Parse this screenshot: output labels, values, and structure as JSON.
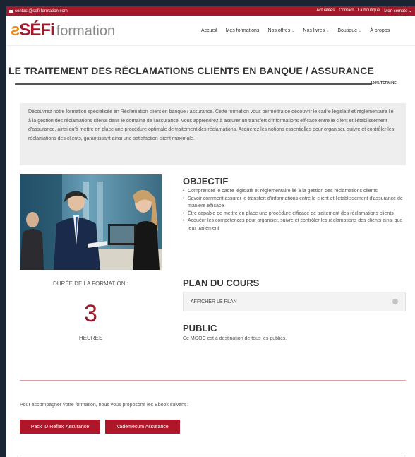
{
  "topbar": {
    "email": "contact@sefi-formation.com",
    "links": [
      "Actualités",
      "Contact",
      "La boutique",
      "Mon compte ⌄"
    ]
  },
  "logo": {
    "brand_z": "ƨ",
    "brand_rest": "SÉFi",
    "word": "formation"
  },
  "nav": [
    {
      "label": "Accueil",
      "has_caret": false
    },
    {
      "label": "Mes formations",
      "has_caret": false
    },
    {
      "label": "Nos offres",
      "has_caret": true
    },
    {
      "label": "Nos livres",
      "has_caret": true
    },
    {
      "label": "Boutique",
      "has_caret": true
    },
    {
      "label": "À propos",
      "has_caret": false
    }
  ],
  "page_title": "LE TRAITEMENT DES RÉCLAMATIONS CLIENTS EN BANQUE / ASSURANCE",
  "progress": {
    "percent": 100,
    "label": "100% TERMINÉ"
  },
  "intro": "Découvrez notre formation spécialisée en Réclamation client en banque / assurance. Cette formation vous permettra de découvrir le cadre législatif et réglementaire lié à la gestion des réclamations clients dans le domaine de l'assurance. Vous apprendrez à assurer un transfert d'informations efficace entre le client et l'établissement d'assurance, ainsi qu'à mettre en place une procédure optimale de traitement des réclamations. Acquérez les notions essentielles pour organiser, suivre et contrôler les réclamations des clients, garantissant ainsi une satisfaction client maximale.",
  "duration": {
    "label": "DURÉE DE LA FORMATION :",
    "value": "3",
    "unit": "HEURES"
  },
  "objective": {
    "title": "OBJECTIF",
    "items": [
      "Comprendre le cadre législatif et réglementaire lié à la gestion des réclamations clients",
      "Savoir comment assurer le transfert d'informations entre le client et l'établissement d'assurance de manière efficace",
      "Être capable de mettre en place une procédure efficace de traitement des réclamations clients",
      "Acquérir les compétences pour organiser, suivre et contrôler les réclamations des clients ainsi que leur traitement"
    ]
  },
  "plan": {
    "title": "PLAN DU COURS",
    "toggle_label": "AFFICHER LE PLAN"
  },
  "public": {
    "title": "PUBLIC",
    "text": "Ce MOOC est à destination de tous les publics."
  },
  "ebooks": {
    "text": "Pour accompagner votre formation, nous vous proposons les Ebook suivant :",
    "buttons": [
      "Pack ID Reflex' Assurance",
      "Vademecum Assurance"
    ]
  },
  "colors": {
    "accent": "#a3182a",
    "orange": "#f08a1c"
  }
}
